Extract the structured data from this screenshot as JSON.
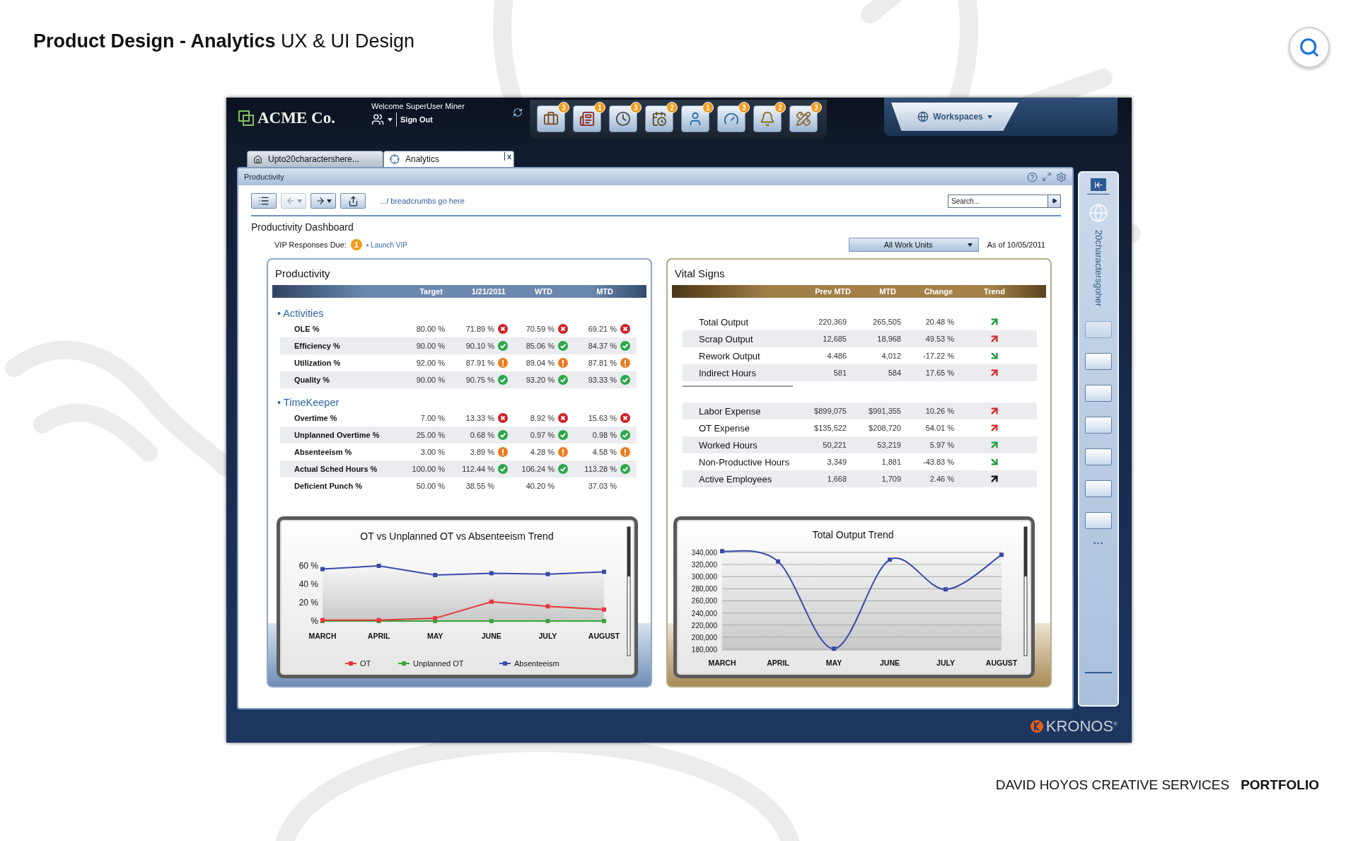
{
  "page": {
    "title": "**Product Design - Analytics** UX & UI Design",
    "footer": [
      {
        "text": "DAVID HOYOS CREATIVE SERVICES",
        "bold": false
      },
      {
        "text": "PORTFOLIO",
        "bold": true
      }
    ]
  },
  "app": {
    "logo": "ACME Co.",
    "welcome": "Welcome SuperUser Miner",
    "sign_out": "Sign Out",
    "toolbar": [
      {
        "kind": "briefcase",
        "badge": "3"
      },
      {
        "kind": "newspaper",
        "badge": "1"
      },
      {
        "kind": "clock",
        "badge": "3"
      },
      {
        "kind": "calendar",
        "badge": "2"
      },
      {
        "kind": "user",
        "badge": "1"
      },
      {
        "kind": "gauge",
        "badge": "3"
      },
      {
        "kind": "bell",
        "badge": "2"
      },
      {
        "kind": "ruler",
        "badge": "3"
      }
    ],
    "workspaces": "Workspaces",
    "tabs": [
      {
        "kind": "home",
        "label": "Upto20charactershere...",
        "selected": false
      },
      {
        "kind": "analytics",
        "label": "Analytics",
        "selected": true,
        "close": "x"
      }
    ],
    "brand": "KRONOS$^{®}$"
  },
  "panel": {
    "title": "Productivity",
    "tools": [
      {
        "kind": "list",
        "disabled": false
      },
      {
        "kind": "back",
        "disabled": true
      },
      {
        "kind": "forward",
        "disabled": false
      },
      {
        "kind": "export",
        "disabled": false
      }
    ],
    "breadcrumbs": ".../ breadcrumbs go here",
    "search": {
      "placeholder": "Search..."
    },
    "dashboard_title": "Productivity Dashboard",
    "vip": {
      "label": "VIP Responses Due:",
      "count": "1",
      "link": "▪ Launch VIP"
    },
    "work_units": "All Work Units",
    "as_of": "As of 10/05/2011"
  },
  "productivity": {
    "title": "Productivity",
    "columns": [
      "Target",
      "1/21/2011",
      "WTD",
      "MTD"
    ],
    "sections": [
      {
        "title": "• Activities",
        "rows": [
          {
            "label": "OLE %",
            "target": "80.00 %",
            "values": [
              {
                "text": "71.89 %",
                "kind": "bad"
              },
              {
                "text": "70.59 %",
                "kind": "bad"
              },
              {
                "text": "69.21 %",
                "kind": "bad"
              }
            ]
          },
          {
            "label": "Efficiency %",
            "target": "90.00 %",
            "values": [
              {
                "text": "90.10 %",
                "kind": "good"
              },
              {
                "text": "85.06 %",
                "kind": "good"
              },
              {
                "text": "84.37 %",
                "kind": "good"
              }
            ]
          },
          {
            "label": "Utilization %",
            "target": "92.00 %",
            "values": [
              {
                "text": "87.91 %",
                "kind": "warn"
              },
              {
                "text": "89.04 %",
                "kind": "warn"
              },
              {
                "text": "87.81 %",
                "kind": "warn"
              }
            ]
          },
          {
            "label": "Quality %",
            "target": "90.00 %",
            "values": [
              {
                "text": "90.75 %",
                "kind": "good"
              },
              {
                "text": "93.20 %",
                "kind": "good"
              },
              {
                "text": "93.33 %",
                "kind": "good"
              }
            ]
          }
        ]
      },
      {
        "title": "• TimeKeeper",
        "rows": [
          {
            "label": "Overtime %",
            "target": "7.00 %",
            "values": [
              {
                "text": "13.33 %",
                "kind": "bad"
              },
              {
                "text": "8.92 %",
                "kind": "bad"
              },
              {
                "text": "15.63 %",
                "kind": "bad"
              }
            ]
          },
          {
            "label": "Unplanned Overtime %",
            "target": "25.00 %",
            "values": [
              {
                "text": "0.68 %",
                "kind": "good"
              },
              {
                "text": "0.97 %",
                "kind": "good"
              },
              {
                "text": "0.98 %",
                "kind": "good"
              }
            ]
          },
          {
            "label": "Absenteeism %",
            "target": "3.00 %",
            "values": [
              {
                "text": "3.89 %",
                "kind": "warn"
              },
              {
                "text": "4.28 %",
                "kind": "warn"
              },
              {
                "text": "4.58 %",
                "kind": "warn"
              }
            ]
          },
          {
            "label": "Actual Sched Hours %",
            "target": "100.00 %",
            "values": [
              {
                "text": "112.44 %",
                "kind": "good"
              },
              {
                "text": "106.24 %",
                "kind": "good"
              },
              {
                "text": "113.28 %",
                "kind": "good"
              }
            ]
          },
          {
            "label": "Deficient Punch %",
            "target": "50.00 %",
            "values": [
              {
                "text": "38.55 %",
                "kind": "plain"
              },
              {
                "text": "40.20 %",
                "kind": "plain"
              },
              {
                "text": "37.03 %",
                "kind": "plain"
              }
            ]
          }
        ]
      }
    ],
    "chart_data": {
      "type": "line",
      "title": "OT vs Unplanned OT vs Absenteeism Trend",
      "categories": [
        "MARCH",
        "APRIL",
        "MAY",
        "JUNE",
        "JULY",
        "AUGUST"
      ],
      "ylim": [
        0,
        60
      ],
      "legend": "bottom",
      "yticks": [
        {
          "value": 0,
          "label": "%"
        },
        {
          "value": 20,
          "label": "20 %"
        },
        {
          "value": 40,
          "label": "40 %"
        },
        {
          "value": 60,
          "label": "60 %"
        }
      ],
      "series": [
        {
          "name": "OT",
          "color": "#e8383d",
          "marker": "square",
          "values": [
            1,
            1,
            3,
            21,
            16,
            12.5
          ]
        },
        {
          "name": "Unplanned OT",
          "color": "#3aa53a",
          "marker": "square",
          "values": [
            0,
            0,
            0,
            0,
            0,
            0
          ]
        },
        {
          "name": "Absenteeism",
          "color": "#3a4aa8",
          "marker": "square",
          "values": [
            56.5,
            60,
            50,
            52,
            51,
            53.5
          ]
        }
      ]
    }
  },
  "vital_signs": {
    "title": "Vital Signs",
    "columns": [
      "Prev MTD",
      "MTD",
      "Change",
      "Trend"
    ],
    "groups": [
      {
        "rows": [
          {
            "label": "Total Output",
            "prev": "220,369",
            "mtd": "265,505",
            "change": "20.48 %",
            "kind": "up",
            "color": "#1f9a3e"
          },
          {
            "label": "Scrap Output",
            "prev": "12,685",
            "mtd": "18,968",
            "change": "49.53 %",
            "kind": "up",
            "color": "#d9282d"
          },
          {
            "label": "Rework Output",
            "prev": "4.486",
            "mtd": "4,012",
            "change": "-17.22 %",
            "kind": "down",
            "color": "#1f9a3e"
          },
          {
            "label": "Indirect Hours",
            "prev": "581",
            "mtd": "584",
            "change": "17.65 %",
            "kind": "up",
            "color": "#d9282d"
          }
        ]
      },
      {
        "rows": [
          {
            "label": "Labor Expense",
            "prev": "$899,075",
            "mtd": "$991,355",
            "change": "10.26 %",
            "kind": "up",
            "color": "#d9282d"
          },
          {
            "label": "OT Expense",
            "prev": "$135,522",
            "mtd": "$208,720",
            "change": "54.01 %",
            "kind": "up",
            "color": "#d9282d"
          },
          {
            "label": "Worked Hours",
            "prev": "50,221",
            "mtd": "53,219",
            "change": "5.97 %",
            "kind": "up",
            "color": "#1f9a3e"
          },
          {
            "label": "Non-Productive Hours",
            "prev": "3,349",
            "mtd": "1,881",
            "change": "-43.83 %",
            "kind": "down",
            "color": "#1f9a3e"
          },
          {
            "label": "Active Employees",
            "prev": "1,668",
            "mtd": "1,709",
            "change": "2.46 %",
            "kind": "up",
            "color": "#111111"
          }
        ]
      }
    ],
    "chart_data": {
      "type": "line",
      "title": "Total Output Trend",
      "categories": [
        "MARCH",
        "APRIL",
        "MAY",
        "JUNE",
        "JULY",
        "AUGUST"
      ],
      "ylim": [
        178000,
        345000
      ],
      "grid": true,
      "yticks": [
        {
          "value": 180000,
          "label": "180,000"
        },
        {
          "value": 200000,
          "label": "200,000"
        },
        {
          "value": 220000,
          "label": "220,000"
        },
        {
          "value": 240000,
          "label": "240,000"
        },
        {
          "value": 260000,
          "label": "260,000"
        },
        {
          "value": 280000,
          "label": "280,000"
        },
        {
          "value": 300000,
          "label": "300,000"
        },
        {
          "value": 320000,
          "label": "320,000"
        },
        {
          "value": 340000,
          "label": "340,000"
        }
      ],
      "series": [
        {
          "color": "#3a4aa8",
          "marker": "square",
          "values": [
            342000,
            325000,
            181000,
            328000,
            279000,
            336000
          ]
        }
      ]
    }
  },
  "sidebar": {
    "title": "20charactersgoher",
    "windows": [
      {
        "disabled": true
      },
      {
        "disabled": false
      },
      {
        "disabled": false
      },
      {
        "disabled": false
      },
      {
        "disabled": false
      },
      {
        "disabled": false
      },
      {
        "disabled": false
      }
    ],
    "more": "..."
  }
}
